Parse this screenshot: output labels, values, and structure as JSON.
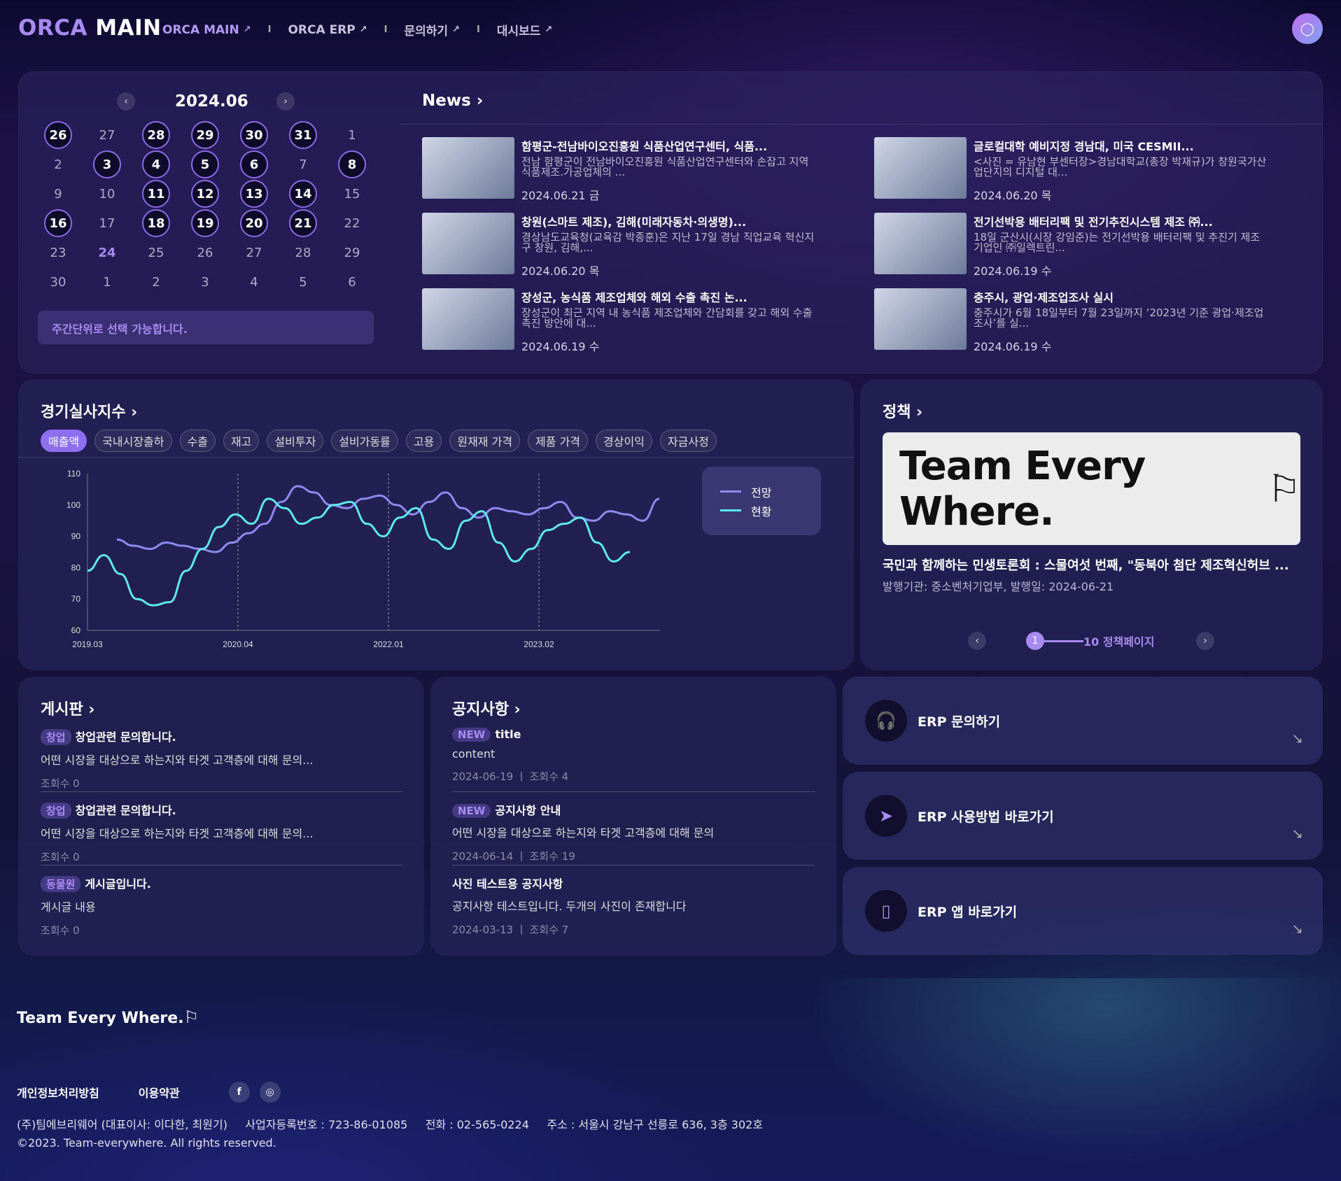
{
  "header": {
    "logo_a": "ORCA",
    "logo_b": " MAIN",
    "nav": [
      "ORCA MAIN",
      "ORCA ERP",
      "문의하기",
      "대시보드"
    ],
    "arrow": "↗"
  },
  "calendar": {
    "month": "2024.06",
    "prev": "‹",
    "next": "›",
    "days": [
      [
        "26",
        true
      ],
      [
        "27",
        false
      ],
      [
        "28",
        true
      ],
      [
        "29",
        true
      ],
      [
        "30",
        true
      ],
      [
        "31",
        true
      ],
      [
        "1",
        false
      ],
      [
        "2",
        false
      ],
      [
        "3",
        true
      ],
      [
        "4",
        true
      ],
      [
        "5",
        true
      ],
      [
        "6",
        true
      ],
      [
        "7",
        false
      ],
      [
        "8",
        true
      ],
      [
        "9",
        false
      ],
      [
        "10",
        false
      ],
      [
        "11",
        true
      ],
      [
        "12",
        true
      ],
      [
        "13",
        true
      ],
      [
        "14",
        true
      ],
      [
        "15",
        false
      ],
      [
        "16",
        true
      ],
      [
        "17",
        false
      ],
      [
        "18",
        true
      ],
      [
        "19",
        true
      ],
      [
        "20",
        true
      ],
      [
        "21",
        true
      ],
      [
        "22",
        false
      ],
      [
        "23",
        false
      ],
      [
        "24",
        "today"
      ],
      [
        "25",
        false
      ],
      [
        "26",
        false
      ],
      [
        "27",
        false
      ],
      [
        "28",
        false
      ],
      [
        "29",
        false
      ],
      [
        "30",
        false
      ],
      [
        "1",
        false
      ],
      [
        "2",
        false
      ],
      [
        "3",
        false
      ],
      [
        "4",
        false
      ],
      [
        "5",
        false
      ],
      [
        "6",
        false
      ]
    ],
    "note": "주간단위로 선택 가능합니다."
  },
  "news": {
    "title": "News ›",
    "items": [
      {
        "title": "함평군-전남바이오진흥원 식품산업연구센터, 식품...",
        "desc": "전남 함평군이 전남바이오진흥원 식품산업연구센터와 손잡고 지역 식품제조.가공업체의 ...",
        "date": "2024.06.21 금"
      },
      {
        "title": "글로컬대학 예비지정 경남대, 미국 CESMII...",
        "desc": "<사진 = 유남현 부센터장>경남대학교(총장 박재규)가 창원국가산업단지의 디지털 대...",
        "date": "2024.06.20 목"
      },
      {
        "title": "창원(스마트 제조), 김해(미래자동차·의생명)...",
        "desc": "경상남도교육청(교육감 박종훈)은 지난 17일 경남 직업교육 혁신지구 창원, 김해,...",
        "date": "2024.06.20 목"
      },
      {
        "title": "전기선박용 배터리팩 및 전기추진시스템 제조 ㈜...",
        "desc": "18일 군산시(시장 강임준)는 전기선박용 배터리팩 및 추진기 제조기업인 ㈜일렉트린...",
        "date": "2024.06.19 수"
      },
      {
        "title": "장성군, 농식품 제조업체와 해외 수출 촉진 논...",
        "desc": "장성군이 최근 지역 내 농식품 제조업체와 간담회를 갖고 해외 수출 촉진 방안에 대...",
        "date": "2024.06.19 수"
      },
      {
        "title": "충주시, 광업·제조업조사 실시",
        "desc": "충주시가 6월 18일부터 7월 23일까지 ‘2023년 기준 광업·제조업조사’를 실...",
        "date": "2024.06.19 수"
      }
    ]
  },
  "economy": {
    "title": "경기실사지수 ›",
    "tabs": [
      "매출액",
      "국내시장출하",
      "수출",
      "재고",
      "설비투자",
      "설비가동률",
      "고용",
      "원재재 가격",
      "제품 가격",
      "경상이익",
      "자금사정"
    ],
    "legend": [
      "전망",
      "현황"
    ]
  },
  "chart_data": {
    "type": "line",
    "ylim": [
      60,
      110
    ],
    "yticks": [
      "110",
      "100",
      "90",
      "80",
      "70",
      "60"
    ],
    "xticks": [
      "2019.03",
      "2020.04",
      "2022.01",
      "2023.02"
    ],
    "series": [
      {
        "name": "전망",
        "color": "#8e8af2",
        "values": [
          89,
          87,
          86,
          88,
          87,
          86,
          85,
          88,
          91,
          94,
          101,
          106,
          104,
          100,
          99,
          102,
          103,
          100,
          97,
          101,
          104,
          99,
          96,
          99,
          98,
          97,
          99,
          101,
          96,
          95,
          98,
          97,
          95,
          102
        ]
      },
      {
        "name": "현황",
        "color": "#5ee8f0",
        "values": [
          79,
          84,
          78,
          70,
          68,
          69,
          79,
          86,
          93,
          97,
          94,
          102,
          99,
          94,
          96,
          100,
          101,
          94,
          90,
          96,
          99,
          89,
          86,
          95,
          98,
          88,
          82,
          86,
          92,
          94,
          96,
          88,
          82,
          85
        ]
      }
    ]
  },
  "policy": {
    "title": "정책 ›",
    "image_text": "Team Every Where.",
    "item_title": "국민과 함께하는 민생토론회 : 스물여섯 번째, \"동북아 첨단 제조혁신허브 ...",
    "item_sub": "발행기관: 중소벤처기업부, 발행일: 2024-06-21",
    "page": "1",
    "pages": "10 정책페이지",
    "prev": "‹",
    "next": "›"
  },
  "board": {
    "title": "게시판 ›",
    "posts": [
      {
        "tag": "창업",
        "title": "창업관련 문의합니다.",
        "desc": "어떤 시장을 대상으로 하는지와 타겟 고객층에 대해 문의...",
        "meta": "조회수 0"
      },
      {
        "tag": "창업",
        "title": "창업관련 문의합니다.",
        "desc": "어떤 시장을 대상으로 하는지와 타겟 고객층에 대해 문의...",
        "meta": "조회수 0"
      },
      {
        "tag": "동물원",
        "title": "게시글입니다.",
        "desc": "게시글 내용",
        "meta": "조회수 0"
      }
    ]
  },
  "notice": {
    "title": "공지사항 ›",
    "posts": [
      {
        "tag": "NEW",
        "title": "title",
        "desc": "content",
        "meta": "2024-06-19 ㅣ 조회수 4"
      },
      {
        "tag": "NEW",
        "title": "공지사항 안내",
        "desc": "어떤 시장을 대상으로 하는지와 타겟 고객층에 대해 문의",
        "meta": "2024-06-14 ㅣ 조회수 19"
      },
      {
        "tag": "",
        "title": "사진 테스트용 공지사항",
        "desc": "공지사항 테스트입니다. 두개의 사진이 존재합니다",
        "meta": "2024-03-13 ㅣ 조회수 7"
      }
    ]
  },
  "erp": [
    {
      "label": "ERP 문의하기",
      "icon": "headphones-icon"
    },
    {
      "label": "ERP 사용방법 바로가기",
      "icon": "send-icon"
    },
    {
      "label": "ERP 앱 바로가기",
      "icon": "mobile-icon"
    }
  ],
  "footer": {
    "logo": "Team Every Where.",
    "privacy": "개인정보처리방침",
    "terms": "이용약관",
    "line1": "(주)팀에브리웨어 (대표이사: 이다한, 최원기)     사업자등록번호 : 723-86-01085     전화 : 02-565-0224     주소 : 서울시 강남구 선릉로 636, 3층 302호",
    "line2": "©2023. Team-everywhere. All rights reserved."
  }
}
